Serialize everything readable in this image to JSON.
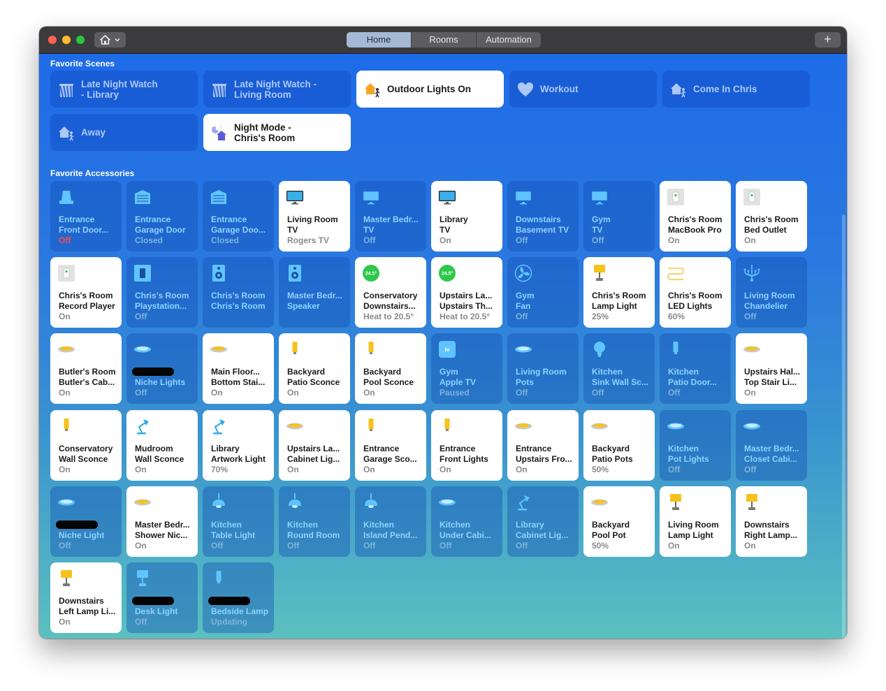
{
  "toolbar": {
    "tabs": [
      {
        "label": "Home",
        "active": true
      },
      {
        "label": "Rooms",
        "active": false
      },
      {
        "label": "Automation",
        "active": false
      }
    ],
    "add_label": "+"
  },
  "sections": {
    "scenes_title": "Favorite Scenes",
    "accessories_title": "Favorite Accessories"
  },
  "scenes": [
    {
      "name1": "Late Night Watch",
      "name2": "- Library",
      "icon": "theater-icon",
      "on": false
    },
    {
      "name1": "Late Night Watch -",
      "name2": "Living Room",
      "icon": "theater-icon",
      "on": false
    },
    {
      "name1": "Outdoor Lights On",
      "name2": "",
      "icon": "house-arrive-icon",
      "on": true
    },
    {
      "name1": "Workout",
      "name2": "",
      "icon": "heart-icon",
      "on": false
    },
    {
      "name1": "Come In Chris",
      "name2": "",
      "icon": "house-arrive-icon",
      "on": false
    },
    {
      "name1": "Away",
      "name2": "",
      "icon": "house-leave-icon",
      "on": false
    },
    {
      "name1": "Night Mode -",
      "name2": "Chris's Room",
      "icon": "night-house-icon",
      "on": true
    }
  ],
  "accessories": [
    {
      "line1": "Entrance",
      "line2": "Front Door...",
      "status": "Off",
      "on": false,
      "icon": "lock-icon",
      "status_color": "#ff4a4a"
    },
    {
      "line1": "Entrance",
      "line2": "Garage Door",
      "status": "Closed",
      "on": false,
      "icon": "garage-icon"
    },
    {
      "line1": "Entrance",
      "line2": "Garage Doo...",
      "status": "Closed",
      "on": false,
      "icon": "garage-icon"
    },
    {
      "line1": "Living Room",
      "line2": "TV",
      "status": "Rogers TV",
      "on": true,
      "icon": "tv-icon"
    },
    {
      "line1": "Master Bedr...",
      "line2": "TV",
      "status": "Off",
      "on": false,
      "icon": "tv-icon"
    },
    {
      "line1": "Library",
      "line2": "TV",
      "status": "On",
      "on": true,
      "icon": "tv-icon"
    },
    {
      "line1": "Downstairs",
      "line2": "Basement TV",
      "status": "Off",
      "on": false,
      "icon": "tv-icon"
    },
    {
      "line1": "Gym",
      "line2": "TV",
      "status": "Off",
      "on": false,
      "icon": "tv-icon"
    },
    {
      "line1": "Chris's Room",
      "line2": "MacBook Pro",
      "status": "On",
      "on": true,
      "icon": "outlet-icon"
    },
    {
      "line1": "Chris's Room",
      "line2": "Bed Outlet",
      "status": "On",
      "on": true,
      "icon": "outlet-icon"
    },
    {
      "line1": "Chris's Room",
      "line2": "Record Player",
      "status": "On",
      "on": true,
      "icon": "outlet-icon"
    },
    {
      "line1": "Chris's Room",
      "line2": "Playstation...",
      "status": "Off",
      "on": false,
      "icon": "switch-icon"
    },
    {
      "line1": "Chris's Room",
      "line2": "Chris's Room",
      "status": "",
      "on": false,
      "icon": "speaker-icon"
    },
    {
      "line1": "Master Bedr...",
      "line2": "Speaker",
      "status": "",
      "on": false,
      "icon": "speaker-icon"
    },
    {
      "line1": "Conservatory",
      "line2": "Downstairs...",
      "status": "Heat to 20.5°",
      "on": true,
      "icon": "thermostat-icon",
      "badge": "24.5°"
    },
    {
      "line1": "Upstairs La...",
      "line2": "Upstairs Th...",
      "status": "Heat to 20.5°",
      "on": true,
      "icon": "thermostat-icon",
      "badge": "24.5°"
    },
    {
      "line1": "Gym",
      "line2": "Fan",
      "status": "Off",
      "on": false,
      "icon": "fan-icon"
    },
    {
      "line1": "Chris's Room",
      "line2": "Lamp Light",
      "status": "25%",
      "on": true,
      "icon": "lamp-icon"
    },
    {
      "line1": "Chris's Room",
      "line2": "LED Lights",
      "status": "60%",
      "on": true,
      "icon": "led-strip-icon"
    },
    {
      "line1": "Living Room",
      "line2": "Chandelier",
      "status": "Off",
      "on": false,
      "icon": "chandelier-icon"
    },
    {
      "line1": "Butler's Room",
      "line2": "Butler's Cab...",
      "status": "On",
      "on": true,
      "icon": "recessed-light-icon"
    },
    {
      "line1": "'s Ro...",
      "line2": "Niche Lights",
      "status": "Off",
      "on": false,
      "icon": "recessed-light-icon",
      "redact": true
    },
    {
      "line1": "Main Floor...",
      "line2": "Bottom Stai...",
      "status": "On",
      "on": true,
      "icon": "recessed-light-icon"
    },
    {
      "line1": "Backyard",
      "line2": "Patio Sconce",
      "status": "On",
      "on": true,
      "icon": "sconce-icon"
    },
    {
      "line1": "Backyard",
      "line2": "Pool Sconce",
      "status": "On",
      "on": true,
      "icon": "sconce-icon"
    },
    {
      "line1": "Gym",
      "line2": "Apple TV",
      "status": "Paused",
      "on": false,
      "icon": "apple-tv-icon"
    },
    {
      "line1": "Living Room",
      "line2": "Pots",
      "status": "Off",
      "on": false,
      "icon": "recessed-light-icon"
    },
    {
      "line1": "Kitchen",
      "line2": "Sink Wall Sc...",
      "status": "Off",
      "on": false,
      "icon": "bulb-icon"
    },
    {
      "line1": "Kitchen",
      "line2": "Patio Door...",
      "status": "Off",
      "on": false,
      "icon": "sconce-icon"
    },
    {
      "line1": "Upstairs Hal...",
      "line2": "Top Stair Li...",
      "status": "On",
      "on": true,
      "icon": "recessed-light-icon"
    },
    {
      "line1": "Conservatory",
      "line2": "Wall Sconce",
      "status": "On",
      "on": true,
      "icon": "sconce-icon"
    },
    {
      "line1": "Mudroom",
      "line2": "Wall Sconce",
      "status": "On",
      "on": true,
      "icon": "desk-lamp-icon"
    },
    {
      "line1": "Library",
      "line2": "Artwork Light",
      "status": "70%",
      "on": true,
      "icon": "desk-lamp-icon"
    },
    {
      "line1": "Upstairs La...",
      "line2": "Cabinet Lig...",
      "status": "On",
      "on": true,
      "icon": "recessed-light-icon"
    },
    {
      "line1": "Entrance",
      "line2": "Garage Sco...",
      "status": "On",
      "on": true,
      "icon": "sconce-icon"
    },
    {
      "line1": "Entrance",
      "line2": "Front Lights",
      "status": "On",
      "on": true,
      "icon": "sconce-icon"
    },
    {
      "line1": "Entrance",
      "line2": "Upstairs Fro...",
      "status": "On",
      "on": true,
      "icon": "recessed-light-icon"
    },
    {
      "line1": "Backyard",
      "line2": "Patio Pots",
      "status": "50%",
      "on": true,
      "icon": "recessed-light-icon"
    },
    {
      "line1": "Kitchen",
      "line2": "Pot Lights",
      "status": "Off",
      "on": false,
      "icon": "recessed-light-icon"
    },
    {
      "line1": "Master Bedr...",
      "line2": "Closet Cabi...",
      "status": "Off",
      "on": false,
      "icon": "recessed-light-icon"
    },
    {
      "line1": "'s...",
      "line2": "Niche Light",
      "status": "Off",
      "on": false,
      "icon": "recessed-light-icon",
      "redact": true
    },
    {
      "line1": "Master Bedr...",
      "line2": "Shower Nic...",
      "status": "On",
      "on": true,
      "icon": "recessed-light-icon"
    },
    {
      "line1": "Kitchen",
      "line2": "Table Light",
      "status": "Off",
      "on": false,
      "icon": "pendant-icon"
    },
    {
      "line1": "Kitchen",
      "line2": "Round Room",
      "status": "Off",
      "on": false,
      "icon": "pendant-icon"
    },
    {
      "line1": "Kitchen",
      "line2": "Island Pend...",
      "status": "Off",
      "on": false,
      "icon": "pendant-icon"
    },
    {
      "line1": "Kitchen",
      "line2": "Under Cabi...",
      "status": "Off",
      "on": false,
      "icon": "recessed-light-icon"
    },
    {
      "line1": "Library",
      "line2": "Cabinet Lig...",
      "status": "Off",
      "on": false,
      "icon": "desk-lamp-icon"
    },
    {
      "line1": "Backyard",
      "line2": "Pool Pot",
      "status": "50%",
      "on": true,
      "icon": "recessed-light-icon"
    },
    {
      "line1": "Living Room",
      "line2": "Lamp Light",
      "status": "On",
      "on": true,
      "icon": "lamp-icon"
    },
    {
      "line1": "Downstairs",
      "line2": "Right Lamp...",
      "status": "On",
      "on": true,
      "icon": "lamp-icon"
    },
    {
      "line1": "Downstairs",
      "line2": "Left Lamp Li...",
      "status": "On",
      "on": true,
      "icon": "lamp-icon"
    },
    {
      "line1": "...",
      "line2": "Desk Light",
      "status": "Off",
      "on": false,
      "icon": "lamp-icon",
      "redact": true
    },
    {
      "line1": "'s...",
      "line2": "Bedside Lamp",
      "status": "Updating",
      "on": false,
      "icon": "sconce-icon",
      "redact": true
    }
  ]
}
